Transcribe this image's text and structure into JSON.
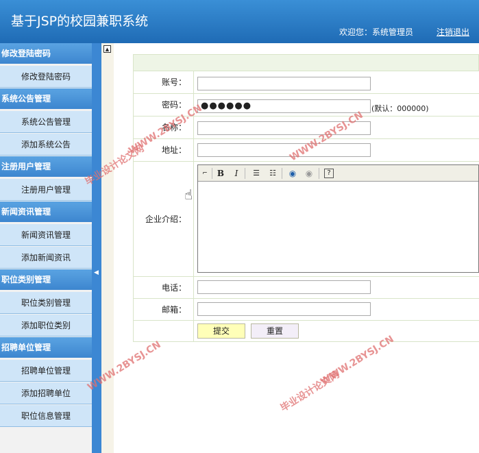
{
  "header": {
    "title": "基于JSP的校园兼职系统",
    "welcome": "欢迎您：系统管理员",
    "logout": "注销退出"
  },
  "sidebar": {
    "groups": [
      {
        "label": "修改登陆密码",
        "items": [
          "修改登陆密码"
        ]
      },
      {
        "label": "系统公告管理",
        "items": [
          "系统公告管理",
          "添加系统公告"
        ]
      },
      {
        "label": "注册用户管理",
        "items": [
          "注册用户管理"
        ]
      },
      {
        "label": "新闻资讯管理",
        "items": [
          "新闻资讯管理",
          "添加新闻资讯"
        ]
      },
      {
        "label": "职位类别管理",
        "items": [
          "职位类别管理",
          "添加职位类别"
        ]
      },
      {
        "label": "招聘单位管理",
        "items": [
          "招聘单位管理",
          "添加招聘单位",
          "职位信息管理"
        ]
      }
    ]
  },
  "form": {
    "account_label": "账号：",
    "account_value": "",
    "password_label": "密码：",
    "password_value": "●●●●●●",
    "password_hint": "(默认：000000)",
    "name_label": "名称：",
    "name_value": "",
    "address_label": "地址：",
    "address_value": "",
    "intro_label": "企业介绍：",
    "phone_label": "电话：",
    "phone_value": "",
    "email_label": "邮箱：",
    "email_value": "",
    "submit_label": "提交",
    "reset_label": "重置"
  },
  "editor_toolbar": {
    "bold": "B",
    "italic": "I",
    "help": "?"
  },
  "watermarks": [
    "毕业设计论文网",
    "WWW.2BYSJ.CN"
  ],
  "colors": {
    "header": "#2a7cc7",
    "menu_group": "#4a96dc",
    "menu_item": "#cfe5f8",
    "submit": "#ffffb8",
    "reset": "#f3eef8"
  }
}
